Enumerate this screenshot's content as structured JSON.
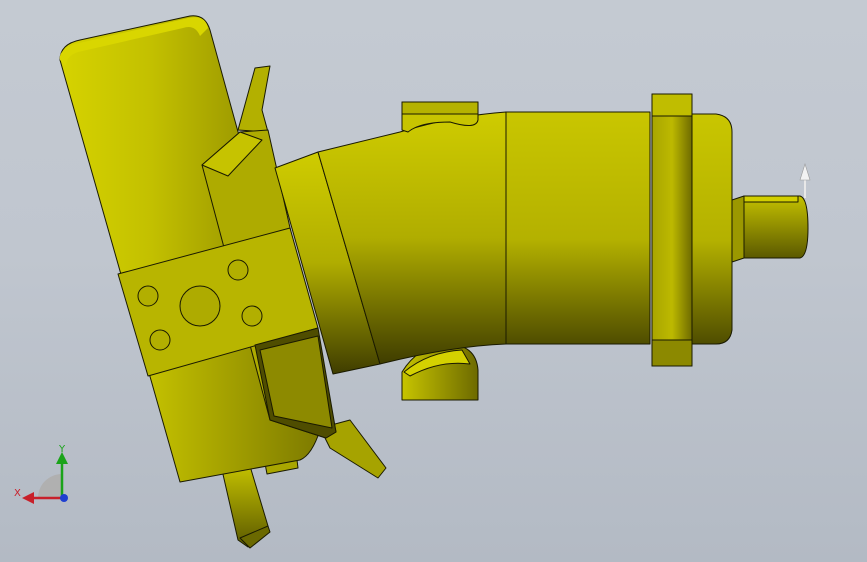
{
  "viewport": {
    "background_top": "#c4cad2",
    "background_bottom": "#b3bac4"
  },
  "model": {
    "part_color": "#bfbc00",
    "shade_color": "#8a8600",
    "dark_color": "#5a5800",
    "edge_color": "#1a1a00"
  },
  "triad": {
    "x_label": "X",
    "y_label": "Y",
    "x_color": "#c8202a",
    "y_color": "#1aa31a",
    "z_color": "#1f3fd0"
  },
  "axis_arrow_icon": "arrow-up-icon"
}
